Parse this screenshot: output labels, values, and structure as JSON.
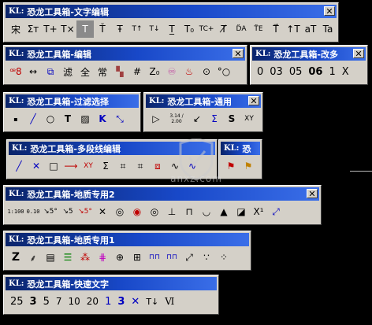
{
  "window1": {
    "prefix": "KL:",
    "title": "恐龙工具箱-文字编辑",
    "close": "✕",
    "buttons": [
      "宋",
      "Σт",
      "T+",
      "T×",
      "T",
      "Ť",
      "Ŧ",
      "T↑",
      "T↓",
      "T̲",
      "T₀",
      "TC+",
      "T̸",
      "D̈A",
      "T̈E",
      "T⃗",
      "↑T",
      "aT",
      "Ta"
    ]
  },
  "window2": {
    "prefix": "KL:",
    "title": "恐龙工具箱-编辑",
    "close": "✕",
    "buttons": [
      "ꟹ8",
      "↔",
      "⧉",
      "滤",
      "全",
      "常",
      "▚",
      "#",
      "Z₀",
      "♾",
      "♨",
      "⊙",
      "°○"
    ]
  },
  "window3": {
    "prefix": "KL:",
    "title": "恐龙工具箱-改多",
    "close": "✕",
    "buttons": [
      "0",
      "03",
      "05",
      "06",
      "1",
      "X"
    ]
  },
  "window4": {
    "prefix": "KL:",
    "title": "恐龙工具箱-过滤选择",
    "close": "✕",
    "buttons": [
      "▪",
      "╱",
      "○",
      "T",
      "▨",
      "K",
      "⤡"
    ]
  },
  "window5": {
    "prefix": "KL:",
    "title": "恐龙工具箱-通用",
    "close": "✕",
    "buttons": [
      "▷",
      "3.14 / 2.00",
      "↙",
      "Σ",
      "S",
      "XY"
    ]
  },
  "window6": {
    "prefix": "KL:",
    "title": "恐龙工具箱-多段线编辑",
    "close": "✕",
    "buttons": [
      "╱",
      "✕",
      "□",
      "⟶",
      "XY",
      "Σ",
      "⌗",
      "⌗",
      "⧈",
      "∿",
      "∿"
    ]
  },
  "window7": {
    "prefix": "KL:",
    "title": "恐",
    "close": "✕",
    "buttons": [
      "⚑",
      "⚑"
    ]
  },
  "window8": {
    "prefix": "KL:",
    "title": "恐龙工具箱-地质专用2",
    "close": "✕",
    "buttons": [
      "1:100",
      "0.10",
      "↘5°",
      "↘5",
      "↘5°",
      "✕",
      "◎",
      "◉",
      "◎",
      "⊥",
      "⊓",
      "◡",
      "▲",
      "◪",
      "X¹",
      "⤢"
    ]
  },
  "window9": {
    "prefix": "KL:",
    "title": "恐龙工具箱-地质专用1",
    "close": "✕",
    "buttons": [
      "Z",
      "⸙",
      "▤",
      "☰",
      "⁂",
      "⋕",
      "⊕",
      "⊞",
      "⊓⊓",
      "⊓⊓",
      "⤢",
      "∵",
      "⁘"
    ]
  },
  "window10": {
    "prefix": "KL:",
    "title": "恐龙工具箱-快速文字",
    "close": "✕",
    "buttons": [
      "25",
      "3",
      "5",
      "7",
      "10",
      "20",
      "1",
      "3",
      "✕",
      "T↓",
      "Ⅵ"
    ]
  },
  "watermark": {
    "text": "anxz.com"
  }
}
